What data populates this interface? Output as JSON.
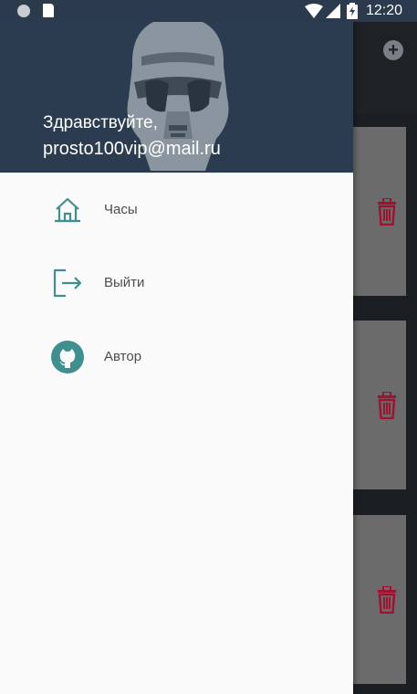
{
  "status_bar": {
    "time": "12:20"
  },
  "drawer": {
    "greeting": "Здравствуйте,",
    "email": "prosto100vip@mail.ru",
    "items": [
      {
        "label": "Часы",
        "icon": "home-icon"
      },
      {
        "label": "Выйти",
        "icon": "logout-icon"
      },
      {
        "label": "Автор",
        "icon": "github-icon"
      }
    ]
  },
  "background_app": {
    "add_icon": "add-circle-icon",
    "cards": [
      {
        "icon": "trash-icon"
      },
      {
        "icon": "trash-icon"
      },
      {
        "icon": "trash-icon"
      }
    ]
  },
  "colors": {
    "header": "#2b3c50",
    "accent_teal": "#3f8f8f",
    "trash_red": "#a01030",
    "drawer_bg": "#fafafa"
  }
}
